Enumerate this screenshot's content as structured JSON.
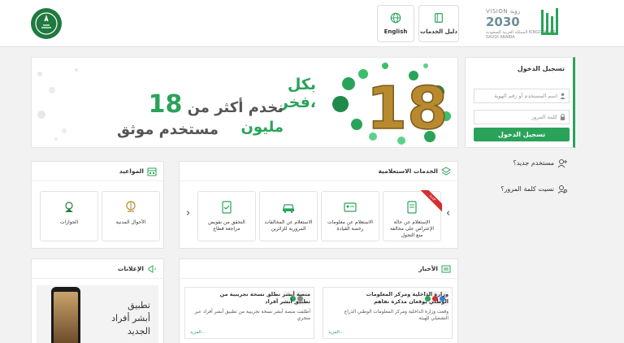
{
  "header": {
    "english_label": "English",
    "guide_label": "دليل الخدمات",
    "vision_label": "VISION رؤية",
    "vision_year": "2030",
    "vision_subtitle": "المملكة العربية السعودية KINGDOM OF SAUDI ARABIA"
  },
  "banner": {
    "line1": "بكل فخر،",
    "line2_prefix": "نخدم أكثر من",
    "line2_number": "18",
    "line2_suffix": "مليون",
    "line3": "مستخدم موثق",
    "big_number": "18"
  },
  "login": {
    "title": "تسجيل الدخول",
    "username_placeholder": "اسم المستخدم أو رقم الهوية",
    "password_placeholder": "كلمة المرور",
    "button": "تسجيل الدخول"
  },
  "links": {
    "new_user": "مستخدم جديد؟",
    "forgot_password": "نسيت كلمة المرور؟"
  },
  "appointments": {
    "title": "المواعيد",
    "items": [
      "الأحوال المدنية",
      "الجوازات"
    ]
  },
  "inquiry": {
    "title": "الخدمات الاستعلامية",
    "new_badge": "جديد",
    "items": [
      "الإستعلام عن حالة الإعتراض على مخالفة منع التجول",
      "الاستعلام عن معلومات رخصة القيادة",
      "الاستعلام عن المخالفات المرورية للزائرين",
      "التحقق من تفويض مراجعة قطاع"
    ]
  },
  "news": {
    "title": "الأخبار",
    "items": [
      {
        "title": "وزارة الداخلية ومركز المعلومات الوطني يوقعان مذكرة تفاهم",
        "body": "وقعت وزارة الداخلية ومركز المعلومات الوطني الذراع التشغيلي للهيئة",
        "more": "المزيد..."
      },
      {
        "title": "منصة أبشر تطلق نسخة تجريبية من تطبيق أبشر أفراد",
        "body": "أطلقت منصة أبشر نسخة تجريبية من تطبيق أبشر أفراد عبر متجري",
        "more": "المزيد..."
      }
    ]
  },
  "ads": {
    "title": "الإعلانات",
    "line1": "تطبيق",
    "line2": "أبشر أفراد",
    "line3": "الجديد"
  },
  "colors": {
    "primary": "#2aa35a",
    "badge": "#d32f2f"
  }
}
